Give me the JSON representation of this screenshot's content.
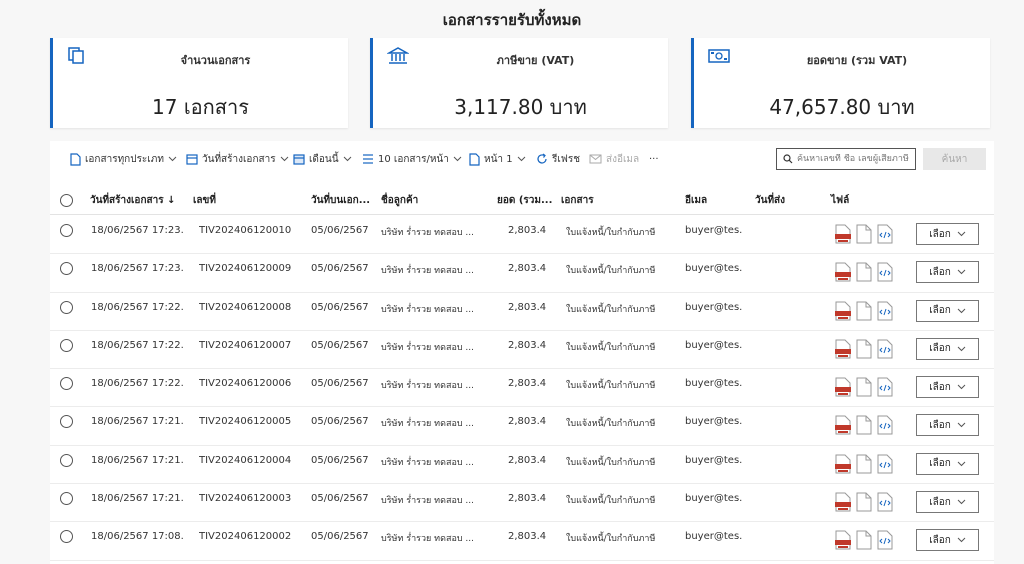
{
  "page": {
    "title": "เอกสารรายรับทั้งหมด"
  },
  "summary": [
    {
      "label": "จำนวนเอกสาร",
      "value": "17 เอกสาร",
      "icon": "copy-icon"
    },
    {
      "label": "ภาษีขาย (VAT)",
      "value": "3,117.80 บาท",
      "icon": "bank-icon"
    },
    {
      "label": "ยอดขาย (รวม VAT)",
      "value": "47,657.80 บาท",
      "icon": "money-icon"
    }
  ],
  "accent_color": "#1565c0",
  "toolbar": {
    "doc_type": "เอกสารทุกประเภท",
    "date_type": "วันที่สร้างเอกสาร",
    "period": "เดือนนี้",
    "page_size": "10 เอกสาร/หน้า",
    "page": "หน้า 1",
    "refresh": "รีเฟรช",
    "send_email": "ส่งอีเมล",
    "more": "···",
    "search_placeholder": "ค้นหาเลขที่ ชื่อ เลขผู้เสียภาษี",
    "search_button": "ค้นหา"
  },
  "columns": {
    "created": "วันที่สร้างเอกสาร ↓",
    "number": "เลขที่",
    "doc_date": "วันที่บนเอก...",
    "customer": "ชื่อลูกค้า",
    "amount": "ยอด (รวม...",
    "document": "เอกสาร",
    "email": "อีเมล",
    "sent_date": "วันที่ส่ง",
    "files": "ไฟล์"
  },
  "rows": [
    {
      "created": "18/06/2567 17:23...",
      "number": "TIV202406120010",
      "doc_date": "05/06/2567",
      "customer": "บริษัท ร่ำรวย ทดสอบ ...",
      "amount": "2,803.40",
      "document": "ใบแจ้งหนี้/ใบกำกับภาษี",
      "email": "buyer@tes...",
      "sent_date": "",
      "action": "เลือก"
    },
    {
      "created": "18/06/2567 17:23...",
      "number": "TIV202406120009",
      "doc_date": "05/06/2567",
      "customer": "บริษัท ร่ำรวย ทดสอบ ...",
      "amount": "2,803.40",
      "document": "ใบแจ้งหนี้/ใบกำกับภาษี",
      "email": "buyer@tes...",
      "sent_date": "",
      "action": "เลือก"
    },
    {
      "created": "18/06/2567 17:22...",
      "number": "TIV202406120008",
      "doc_date": "05/06/2567",
      "customer": "บริษัท ร่ำรวย ทดสอบ ...",
      "amount": "2,803.40",
      "document": "ใบแจ้งหนี้/ใบกำกับภาษี",
      "email": "buyer@tes...",
      "sent_date": "",
      "action": "เลือก"
    },
    {
      "created": "18/06/2567 17:22...",
      "number": "TIV202406120007",
      "doc_date": "05/06/2567",
      "customer": "บริษัท ร่ำรวย ทดสอบ ...",
      "amount": "2,803.40",
      "document": "ใบแจ้งหนี้/ใบกำกับภาษี",
      "email": "buyer@tes...",
      "sent_date": "",
      "action": "เลือก"
    },
    {
      "created": "18/06/2567 17:22...",
      "number": "TIV202406120006",
      "doc_date": "05/06/2567",
      "customer": "บริษัท ร่ำรวย ทดสอบ ...",
      "amount": "2,803.40",
      "document": "ใบแจ้งหนี้/ใบกำกับภาษี",
      "email": "buyer@tes...",
      "sent_date": "",
      "action": "เลือก"
    },
    {
      "created": "18/06/2567 17:21...",
      "number": "TIV202406120005",
      "doc_date": "05/06/2567",
      "customer": "บริษัท ร่ำรวย ทดสอบ ...",
      "amount": "2,803.40",
      "document": "ใบแจ้งหนี้/ใบกำกับภาษี",
      "email": "buyer@tes...",
      "sent_date": "",
      "action": "เลือก"
    },
    {
      "created": "18/06/2567 17:21...",
      "number": "TIV202406120004",
      "doc_date": "05/06/2567",
      "customer": "บริษัท ร่ำรวย ทดสอบ ...",
      "amount": "2,803.40",
      "document": "ใบแจ้งหนี้/ใบกำกับภาษี",
      "email": "buyer@tes...",
      "sent_date": "",
      "action": "เลือก"
    },
    {
      "created": "18/06/2567 17:21...",
      "number": "TIV202406120003",
      "doc_date": "05/06/2567",
      "customer": "บริษัท ร่ำรวย ทดสอบ ...",
      "amount": "2,803.40",
      "document": "ใบแจ้งหนี้/ใบกำกับภาษี",
      "email": "buyer@tes...",
      "sent_date": "",
      "action": "เลือก"
    },
    {
      "created": "18/06/2567 17:08...",
      "number": "TIV202406120002",
      "doc_date": "05/06/2567",
      "customer": "บริษัท ร่ำรวย ทดสอบ ...",
      "amount": "2,803.40",
      "document": "ใบแจ้งหนี้/ใบกำกับภาษี",
      "email": "buyer@tes...",
      "sent_date": "",
      "action": "เลือก"
    }
  ]
}
